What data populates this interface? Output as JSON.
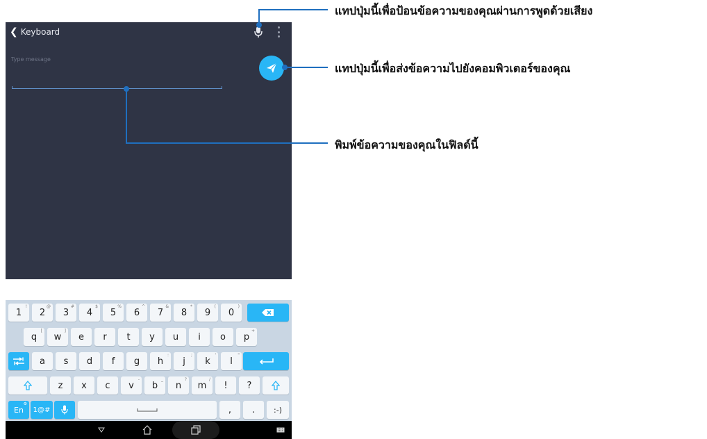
{
  "app": {
    "back_label": "Keyboard",
    "input_placeholder": "Type message"
  },
  "keyboard": {
    "row1": [
      {
        "label": "1",
        "sup": "!"
      },
      {
        "label": "2",
        "sup": "@"
      },
      {
        "label": "3",
        "sup": "#"
      },
      {
        "label": "4",
        "sup": "$"
      },
      {
        "label": "5",
        "sup": "%"
      },
      {
        "label": "6",
        "sup": "^"
      },
      {
        "label": "7",
        "sup": "&"
      },
      {
        "label": "8",
        "sup": "*"
      },
      {
        "label": "9",
        "sup": "("
      },
      {
        "label": "0",
        "sup": ")"
      }
    ],
    "row2": [
      {
        "label": "q",
        "sup": "["
      },
      {
        "label": "w",
        "sup": "]"
      },
      {
        "label": "e",
        "sup": ""
      },
      {
        "label": "r",
        "sup": ""
      },
      {
        "label": "t",
        "sup": ""
      },
      {
        "label": "y",
        "sup": ""
      },
      {
        "label": "u",
        "sup": ""
      },
      {
        "label": "i",
        "sup": ""
      },
      {
        "label": "o",
        "sup": ""
      },
      {
        "label": "p",
        "sup": "+"
      }
    ],
    "row3": [
      {
        "label": "a",
        "sup": ""
      },
      {
        "label": "s",
        "sup": ""
      },
      {
        "label": "d",
        "sup": ""
      },
      {
        "label": "f",
        "sup": ""
      },
      {
        "label": "g",
        "sup": ""
      },
      {
        "label": "h",
        "sup": ":"
      },
      {
        "label": "j",
        "sup": ";"
      },
      {
        "label": "k",
        "sup": "'"
      },
      {
        "label": "l",
        "sup": "\""
      }
    ],
    "row4": [
      {
        "label": "z",
        "sup": ""
      },
      {
        "label": "x",
        "sup": ""
      },
      {
        "label": "c",
        "sup": ""
      },
      {
        "label": "v",
        "sup": "-"
      },
      {
        "label": "b",
        "sup": "_"
      },
      {
        "label": "n",
        "sup": "?"
      },
      {
        "label": "m",
        "sup": "/"
      },
      {
        "label": "!",
        "sup": ""
      },
      {
        "label": "?",
        "sup": ""
      }
    ],
    "lang_label": "En",
    "symbols_label": "1@#",
    "comma": ",",
    "period": ".",
    "smiley": ":-)"
  },
  "callouts": {
    "mic": "แทปปุ่มนี้เพื่อป้อนข้อความของคุณผ่านการพูดด้วยเสียง",
    "send": "แทปปุ่มนี้เพื่อส่งข้อความไปยังคอมพิวเตอร์ของคุณ",
    "field": "พิมพ์ข้อความของคุณในฟิลด์นี้"
  },
  "colors": {
    "screen_bg": "#2f3445",
    "accent": "#29b6f6",
    "keyboard_bg": "#c9d6e3",
    "callout_line": "#1f6fbf"
  }
}
